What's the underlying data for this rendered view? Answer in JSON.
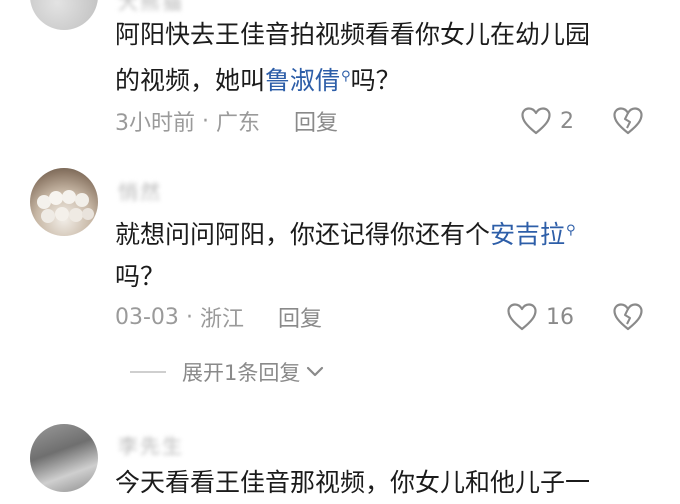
{
  "comments": [
    {
      "username": "大熊猫",
      "content_lines": [
        [
          "阿阳快去王佳音拍视频看看你女儿在幼儿园"
        ],
        [
          "的视频，她叫",
          "鲁淑倩",
          "吗？"
        ]
      ],
      "mention": "鲁淑倩",
      "time": "3小时前",
      "separator": "·",
      "location": "广东",
      "reply_label": "回复",
      "like_count": "2"
    },
    {
      "username": "悄然",
      "content_lines": [
        [
          "就想问问阿阳，你还记得你还有个",
          "安吉拉",
          ""
        ],
        [
          "吗？"
        ]
      ],
      "mention": "安吉拉",
      "time": "03-03",
      "separator": "·",
      "location": "浙江",
      "reply_label": "回复",
      "like_count": "16",
      "expand_replies_label": "展开1条回复"
    },
    {
      "username": "李先生",
      "content_lines": [
        [
          "今天看看王佳音那视频，你女儿和他儿子一"
        ]
      ]
    }
  ],
  "icons": {
    "like": "heart-outline-icon",
    "dislike": "broken-heart-icon",
    "mention": "search-icon",
    "expand": "chevron-down-icon"
  },
  "colors": {
    "mention": "#2d5ea8",
    "meta_text": "#9a9a9a",
    "body_text": "#1b1b1b",
    "icon_gray": "#8a8a8a"
  }
}
